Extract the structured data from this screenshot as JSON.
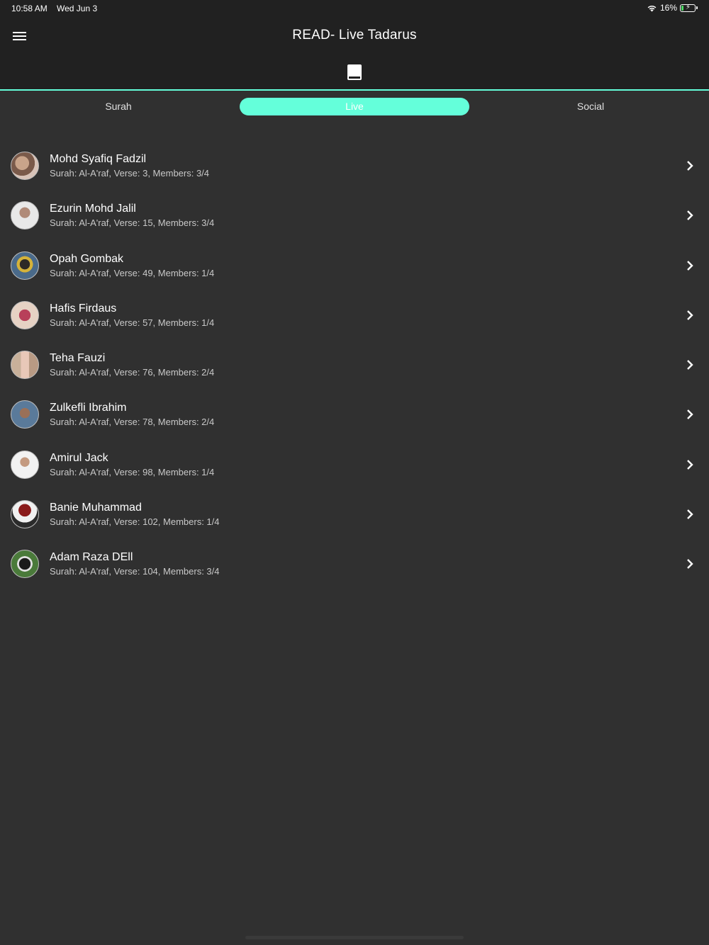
{
  "status_bar": {
    "time": "10:58 AM",
    "date": "Wed Jun 3",
    "battery": "16%",
    "icons": [
      "wifi-icon",
      "battery-charging-icon"
    ]
  },
  "header": {
    "title": "READ- Live Tadarus",
    "menu_icon": "hamburger-menu-icon",
    "logo_icon": "quran-book-icon"
  },
  "tabs": [
    {
      "label": "Surah",
      "active": false
    },
    {
      "label": "Live",
      "active": true
    },
    {
      "label": "Social",
      "active": false
    }
  ],
  "sessions": [
    {
      "name": "Mohd Syafiq Fadzil",
      "detail": "Surah: Al-A'raf, Verse: 3, Members: 3/4"
    },
    {
      "name": "Ezurin Mohd Jalil",
      "detail": "Surah: Al-A'raf, Verse: 15, Members: 3/4"
    },
    {
      "name": "Opah Gombak",
      "detail": "Surah: Al-A'raf, Verse: 49, Members: 1/4"
    },
    {
      "name": "Hafis Firdaus",
      "detail": "Surah: Al-A'raf, Verse: 57, Members: 1/4"
    },
    {
      "name": "Teha Fauzi",
      "detail": "Surah: Al-A'raf, Verse: 76, Members: 2/4"
    },
    {
      "name": "Zulkefli Ibrahim",
      "detail": "Surah: Al-A'raf, Verse: 78, Members: 2/4"
    },
    {
      "name": "Amirul Jack",
      "detail": "Surah: Al-A'raf, Verse: 98, Members: 1/4"
    },
    {
      "name": "Banie Muhammad",
      "detail": "Surah: Al-A'raf, Verse: 102, Members: 1/4"
    },
    {
      "name": "Adam Raza DEll",
      "detail": "Surah: Al-A'raf, Verse: 104, Members: 3/4"
    }
  ],
  "colors": {
    "accent": "#64ffda",
    "header_bg": "#212121",
    "body_bg": "#303030"
  }
}
